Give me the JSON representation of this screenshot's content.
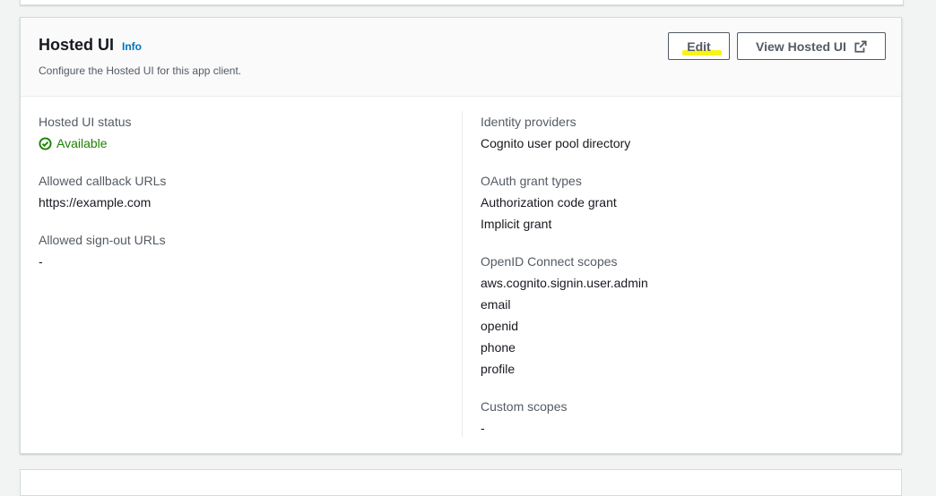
{
  "header": {
    "title": "Hosted UI",
    "info_label": "Info",
    "description": "Configure the Hosted UI for this app client.",
    "edit_label": "Edit",
    "view_label": "View Hosted UI",
    "view_icon": "external-link-icon"
  },
  "left": {
    "status": {
      "label": "Hosted UI status",
      "value": "Available",
      "icon": "status-success-icon",
      "color": "#1d8102"
    },
    "callback": {
      "label": "Allowed callback URLs",
      "values": [
        "https://example.com"
      ]
    },
    "signout": {
      "label": "Allowed sign-out URLs",
      "values": [
        "-"
      ]
    }
  },
  "right": {
    "identity": {
      "label": "Identity providers",
      "values": [
        "Cognito user pool directory"
      ]
    },
    "oauth": {
      "label": "OAuth grant types",
      "values": [
        "Authorization code grant",
        "Implicit grant"
      ]
    },
    "oidc": {
      "label": "OpenID Connect scopes",
      "values": [
        "aws.cognito.signin.user.admin",
        "email",
        "openid",
        "phone",
        "profile"
      ]
    },
    "custom": {
      "label": "Custom scopes",
      "values": [
        "-"
      ]
    }
  },
  "colors": {
    "link": "#0073bb",
    "success": "#1d8102",
    "highlight": "#f8f31a"
  }
}
